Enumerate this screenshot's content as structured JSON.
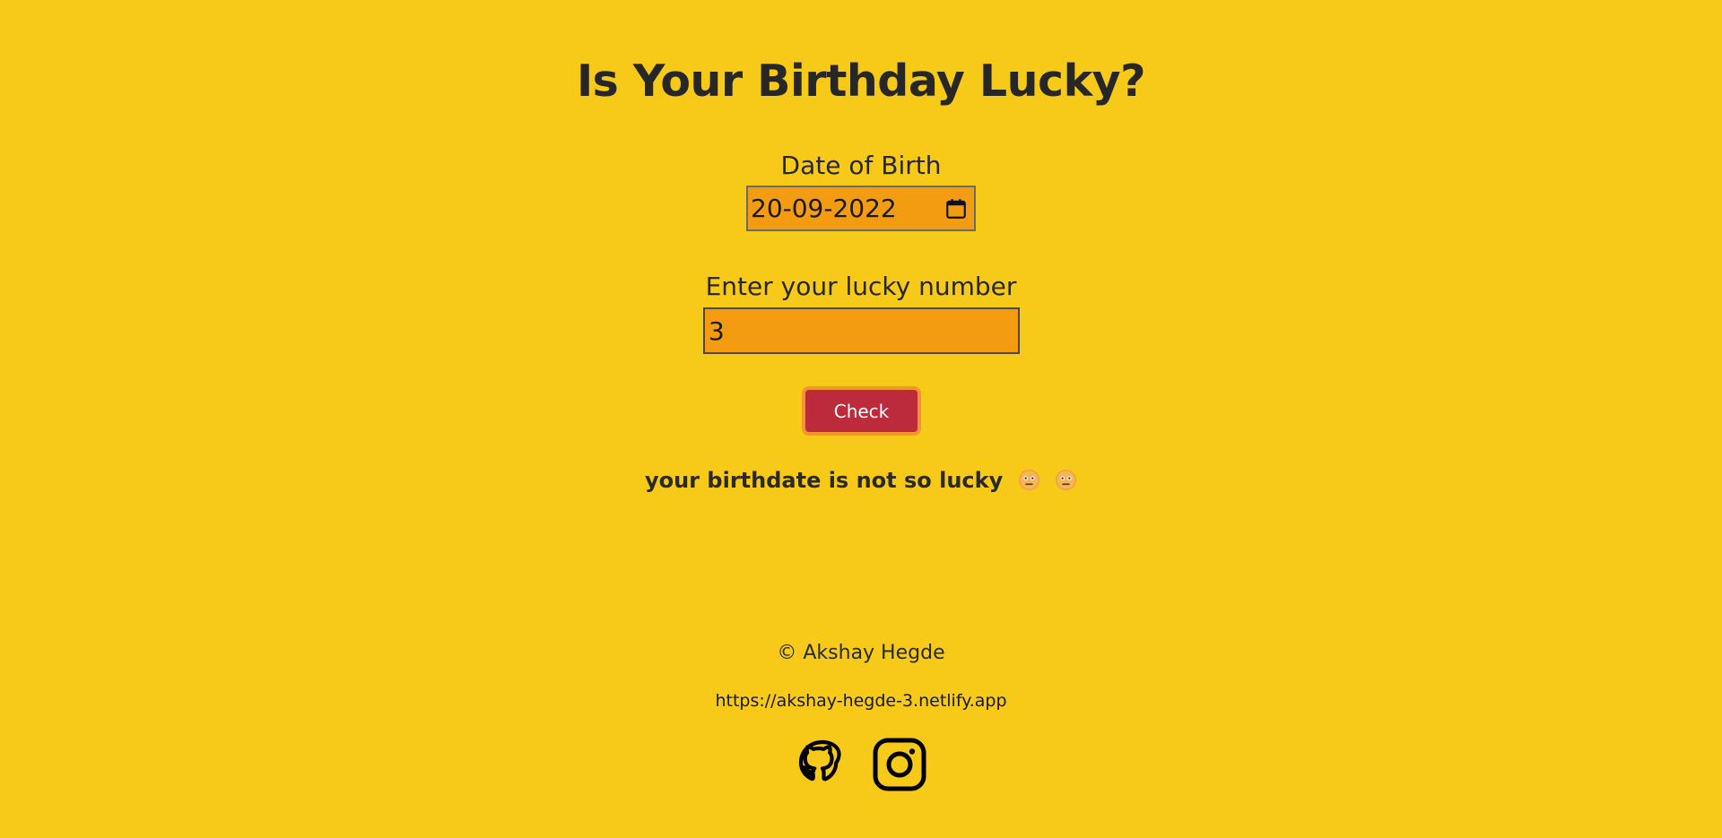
{
  "header": {
    "title": "Is Your Birthday Lucky?"
  },
  "form": {
    "dob_label": "Date of Birth",
    "dob_value": "20-09-2022",
    "lucky_label": "Enter your lucky number",
    "lucky_value": "3",
    "check_label": "Check"
  },
  "result": {
    "message": "your birthdate is not so lucky",
    "emoji_icons": [
      "neutral-face-icon",
      "neutral-face-icon"
    ]
  },
  "footer": {
    "copyright": "© Akshay Hegde",
    "site_url": "https://akshay-hegde-3.netlify.app",
    "social_icons": [
      "github-icon",
      "instagram-icon"
    ]
  },
  "colors": {
    "background": "#f7c918",
    "input_background": "#f39c12",
    "button_background": "#bb2b3b",
    "button_border": "#f0962c",
    "text": "#272727"
  }
}
